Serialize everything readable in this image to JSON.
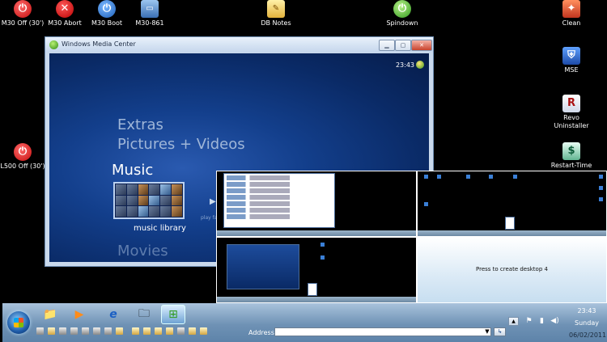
{
  "desktop_icons": [
    {
      "label": "M30 Off (30')",
      "icon": "power-off-icon",
      "glyph": "⏻"
    },
    {
      "label": "M30 Abort",
      "icon": "abort-icon",
      "glyph": "✕"
    },
    {
      "label": "M30 Boot",
      "icon": "boot-icon",
      "glyph": "⏻"
    },
    {
      "label": "M30-861",
      "icon": "computer-icon",
      "glyph": "▭"
    },
    {
      "label": "DB Notes",
      "icon": "notes-icon",
      "glyph": "✎"
    },
    {
      "label": "Spindown",
      "icon": "spindown-icon",
      "glyph": "⏻"
    },
    {
      "label": "Clean",
      "icon": "clean-icon",
      "glyph": "✦"
    },
    {
      "label": "MSE",
      "icon": "mse-icon",
      "glyph": "⛨"
    },
    {
      "label": "Revo Uninstaller",
      "icon": "revo-icon",
      "glyph": "R"
    },
    {
      "label": "Restart-Time",
      "icon": "restart-icon",
      "glyph": "$"
    },
    {
      "label": "L500 Off (30')",
      "icon": "power-off-icon",
      "glyph": "⏻"
    }
  ],
  "wmc": {
    "title": "Windows Media Center",
    "time": "23:43",
    "menu": [
      "Extras",
      "Pictures + Videos",
      "Music",
      "Movies"
    ],
    "tile_label": "music library",
    "play_hint": "play fa",
    "controls": {
      "minimize": "▁",
      "maximize": "▢",
      "close": "✕"
    }
  },
  "desktops": {
    "create_label": "Press to create desktop 4"
  },
  "taskbar": {
    "address_label": "Address",
    "address_value": "",
    "clock_time": "23:43",
    "clock_day": "Sunday",
    "clock_date": "06/02/2011",
    "pinned": [
      {
        "name": "explorer-icon",
        "glyph": "📁"
      },
      {
        "name": "media-player-icon",
        "glyph": "▶"
      },
      {
        "name": "internet-explorer-icon",
        "glyph": "e"
      },
      {
        "name": "folder-icon",
        "glyph": "🗀"
      },
      {
        "name": "media-center-icon",
        "glyph": "⊞"
      }
    ]
  },
  "colors": {
    "desktop_bg": "#000000",
    "wmc_blue": "#133f8c",
    "taskbar": "#6f92b5"
  }
}
